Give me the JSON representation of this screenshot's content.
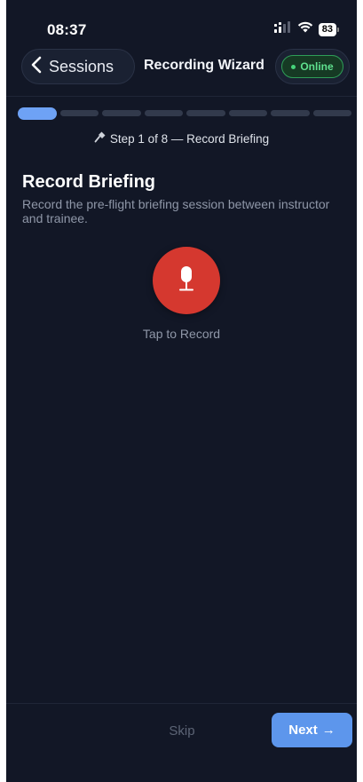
{
  "status_bar": {
    "time": "08:37",
    "battery": "83"
  },
  "header": {
    "back_label": "Sessions",
    "title": "Recording Wizard",
    "status_badge": "Online"
  },
  "progress": {
    "current_step": 1,
    "total_steps": 8,
    "step_text": "Step 1 of 8 — Record Briefing",
    "step_icon": "microphone-icon"
  },
  "content": {
    "title": "Record Briefing",
    "description": "Record the pre-flight briefing session between instructor and trainee.",
    "record_label": "Tap to Record"
  },
  "footer": {
    "skip_label": "Skip",
    "next_label": "Next",
    "next_arrow": "→"
  },
  "colors": {
    "background": "#121726",
    "accent": "#5d96ec",
    "record": "#d5382f",
    "online": "#46d37a"
  }
}
